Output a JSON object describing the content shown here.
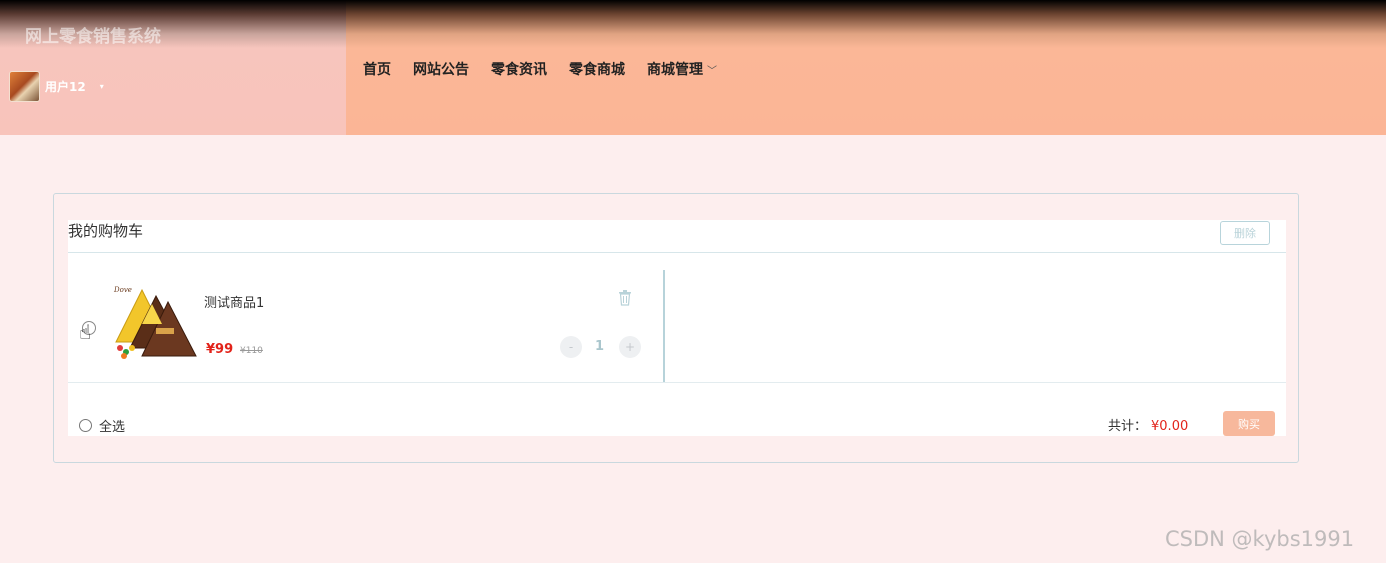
{
  "header": {
    "site_title": "网上零食销售系统",
    "user_name": "用户12",
    "user_caret": "▾",
    "nav": [
      {
        "label": "首页"
      },
      {
        "label": "网站公告"
      },
      {
        "label": "零食资讯"
      },
      {
        "label": "零食商城"
      },
      {
        "label": "商城管理"
      }
    ],
    "nav_dropdown_caret": "﹀"
  },
  "cart": {
    "title": "我的购物车",
    "delete_label": "删除",
    "items": [
      {
        "name": "测试商品1",
        "price": "¥99",
        "original_price": "¥110",
        "quantity": "1",
        "minus_label": "-",
        "plus_label": "+"
      }
    ],
    "select_all_label": "全选",
    "total_label": "共计：",
    "total_value": "¥0.00",
    "buy_label": "购买"
  },
  "watermark": "CSDN @kybs1991",
  "colors": {
    "header_left_bg": "#f8c4bb",
    "header_right_bg": "#fbb596",
    "page_bg": "#fdeeee",
    "price_red": "#e2231a",
    "buy_button": "#f7b89c"
  }
}
